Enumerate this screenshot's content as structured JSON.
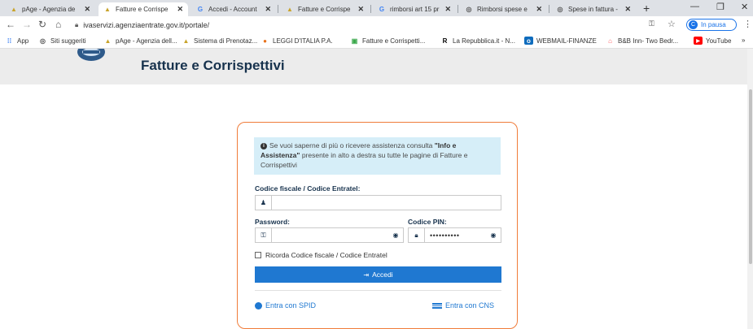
{
  "tabs": [
    {
      "title": "pAge - Agenzia de",
      "icon": "agenzia-entrate-icon",
      "active": false
    },
    {
      "title": "Fatture e Corrispe",
      "icon": "agenzia-entrate-icon",
      "active": true
    },
    {
      "title": "Accedi - Account",
      "icon": "google-icon",
      "active": false
    },
    {
      "title": "Fatture e Corrispe",
      "icon": "agenzia-entrate-icon",
      "active": false
    },
    {
      "title": "rimborsi art 15 pr",
      "icon": "google-icon",
      "active": false
    },
    {
      "title": "Rimborsi spese e",
      "icon": "globe-icon",
      "active": false
    },
    {
      "title": "Spese in fattura -",
      "icon": "globe-icon",
      "active": false
    }
  ],
  "toolbar": {
    "url": "ivaservizi.agenziaentrate.gov.it/portale/",
    "profile_initial": "C",
    "profile_status": "In pausa"
  },
  "bookmarks": [
    {
      "label": "App",
      "icon": "apps-grid-icon"
    },
    {
      "label": "Siti suggeriti",
      "icon": "globe-icon"
    },
    {
      "label": "pAge - Agenzia dell...",
      "icon": "agenzia-entrate-icon"
    },
    {
      "label": "Sistema di Prenotaz...",
      "icon": "agenzia-entrate-icon"
    },
    {
      "label": "LEGGI D'ITALIA P.A.",
      "icon": "leggi-italia-icon"
    },
    {
      "label": "Fatture e Corrispetti...",
      "icon": "fatture-icon"
    },
    {
      "label": "La Repubblica.it - N...",
      "icon": "repubblica-icon"
    },
    {
      "label": "WEBMAIL-FINANZE",
      "icon": "outlook-icon"
    },
    {
      "label": "B&B Inn- Two Bedr...",
      "icon": "airbnb-icon"
    },
    {
      "label": "YouTube",
      "icon": "youtube-icon"
    }
  ],
  "site": {
    "title": "Fatture e Corrispettivi"
  },
  "login": {
    "info_pre": "Se vuoi saperne di più o ricevere assistenza consulta ",
    "info_bold": "\"Info e Assistenza\"",
    "info_post": " presente in alto a destra su tutte le pagine di Fatture e Corrispettivi",
    "codice_label": "Codice fiscale / Codice Entratel:",
    "codice_value": "",
    "password_label": "Password:",
    "password_value": "",
    "pin_label": "Codice PIN:",
    "pin_value": "••••••••••",
    "remember_label": "Ricorda Codice fiscale / Codice Entratel",
    "accedi_label": "Accedi",
    "spid_label": "Entra con SPID",
    "cns_label": "Entra con CNS"
  },
  "colors": {
    "accent": "#1f78d1",
    "card_border": "#f07c3a",
    "info_bg": "#d6eef8",
    "title": "#17324d"
  }
}
